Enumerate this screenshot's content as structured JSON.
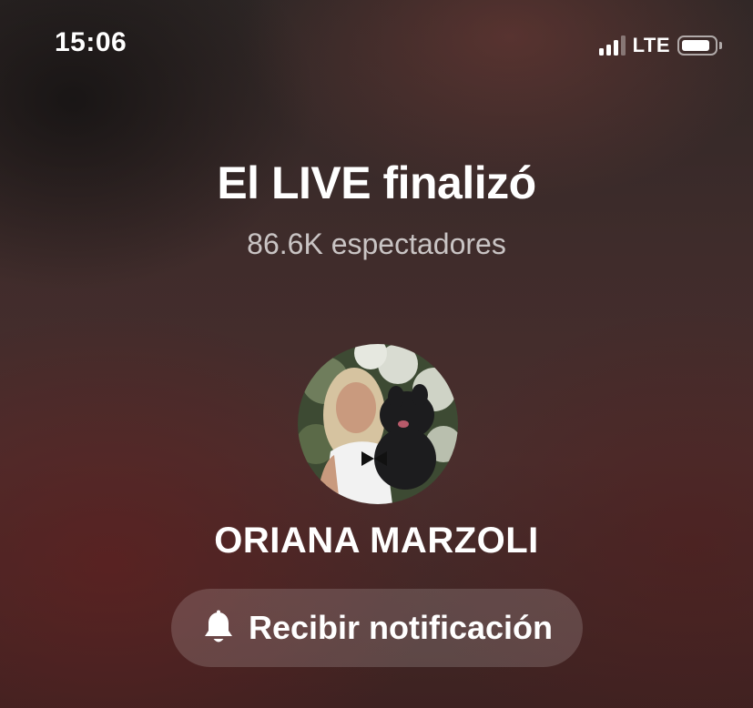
{
  "status_bar": {
    "time": "15:06",
    "network": "LTE",
    "signal_icon": "cellular-signal-icon",
    "battery_icon": "battery-icon"
  },
  "live": {
    "title": "El LIVE finalizó",
    "viewers": "86.6K espectadores"
  },
  "profile": {
    "name": "ORIANA MARZOLI",
    "avatar_icon": "profile-photo"
  },
  "notify_button": {
    "label": "Recibir notificación",
    "icon": "bell-icon"
  }
}
